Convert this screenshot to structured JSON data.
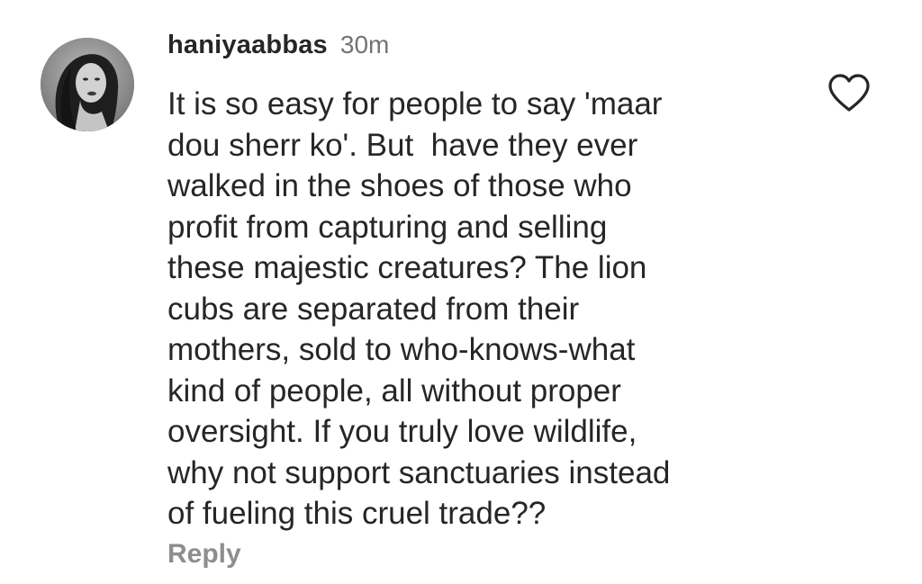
{
  "comment": {
    "username": "haniyaabbas",
    "timestamp": "30m",
    "text_lines": [
      "It is so easy for people to say 'maar",
      "dou sherr ko'. But  have they ever",
      "walked in the shoes of those who",
      "profit from capturing and selling",
      "these majestic creatures? The lion",
      "cubs are separated from their",
      "mothers, sold to who-knows-what",
      "kind of people, all without proper",
      "oversight. If you truly love wildlife,",
      "why not support sanctuaries instead",
      "of fueling this cruel trade??"
    ],
    "reply_label": "Reply",
    "like_icon": "heart-outline-icon",
    "avatar_icon": "profile-photo"
  }
}
